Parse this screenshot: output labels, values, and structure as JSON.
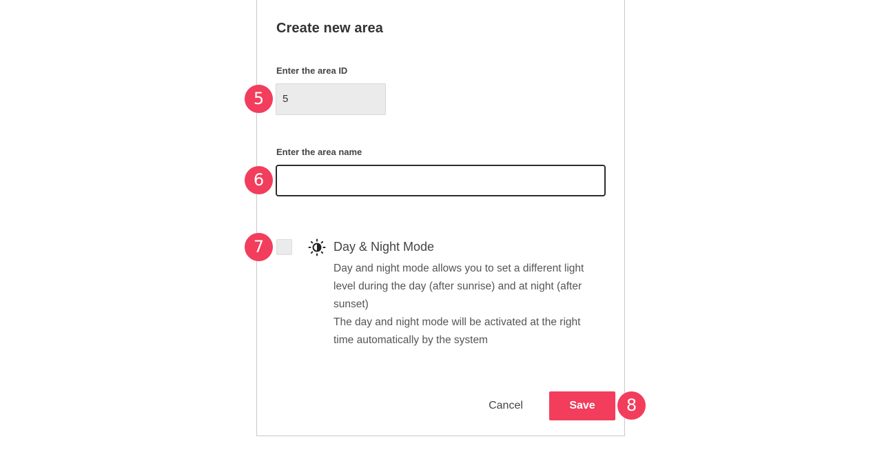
{
  "dialog": {
    "title": "Create new area"
  },
  "area_id": {
    "label": "Enter the area ID",
    "value": "5"
  },
  "area_name": {
    "label": "Enter the area name",
    "value": "",
    "placeholder": ""
  },
  "day_night": {
    "checked": false,
    "icon": "day-night-sun-icon",
    "title": "Day & Night Mode",
    "description_lines": [
      "Day and night mode allows you to set a different light",
      "level during the day (after sunrise) and at night (after",
      "sunset)",
      "The day and night mode will be activated at the right",
      "time automatically by the system"
    ]
  },
  "actions": {
    "cancel_label": "Cancel",
    "save_label": "Save"
  },
  "callouts": [
    "5",
    "6",
    "7",
    "8"
  ],
  "colors": {
    "accent": "#f23d5c",
    "field_background": "#ebebeb",
    "focused_border": "#2b2b2b"
  }
}
